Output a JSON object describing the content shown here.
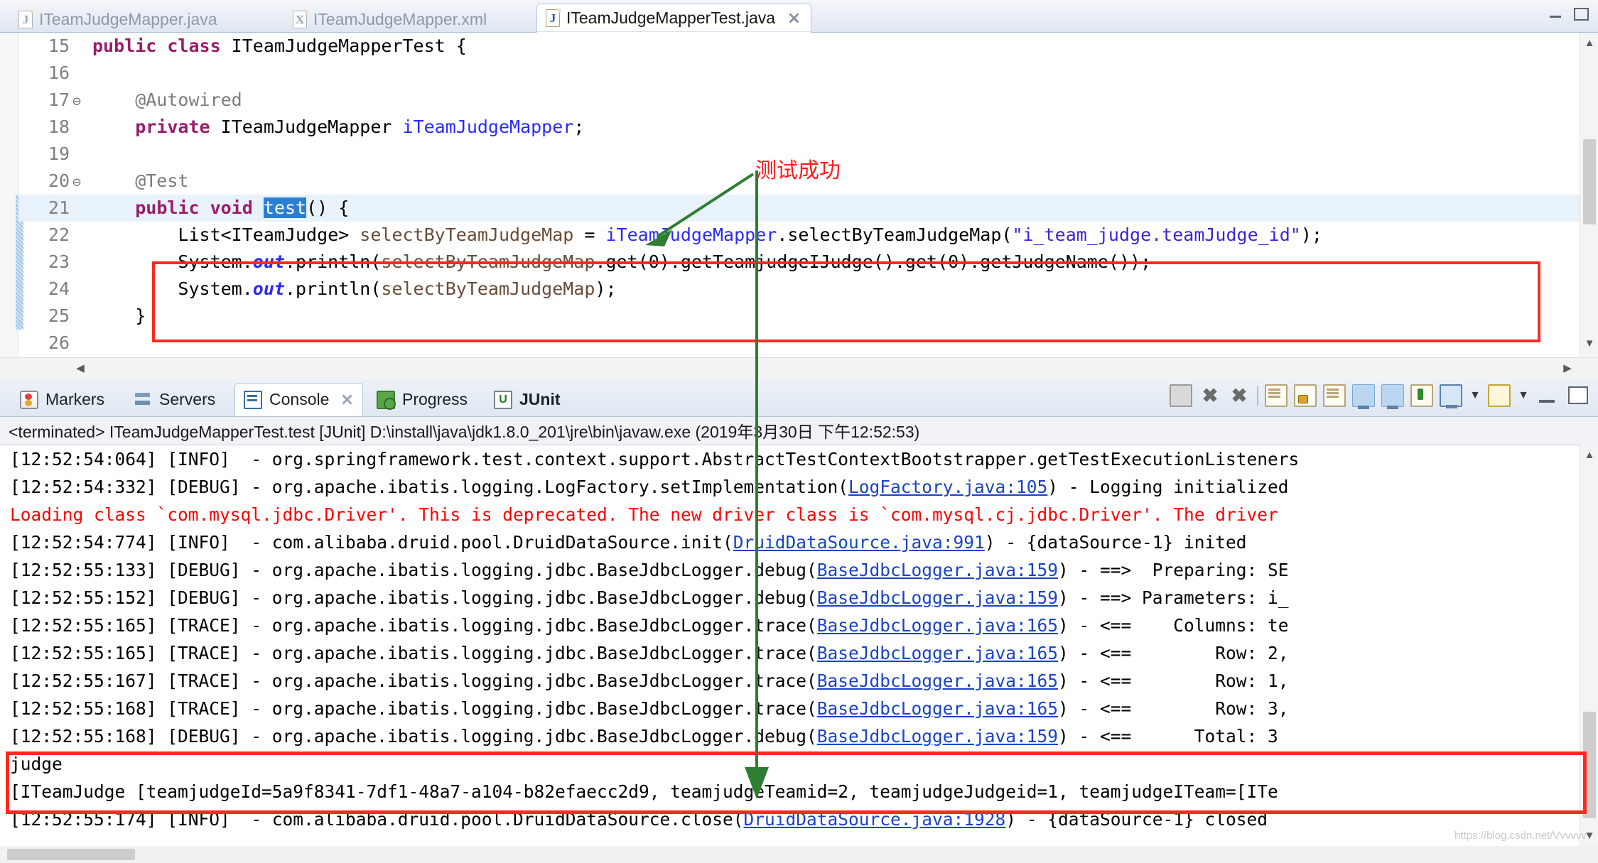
{
  "editor_tabs": [
    {
      "label": "ITeamJudgeMapper.java",
      "icon": "java-file-icon",
      "active": false,
      "closable": false
    },
    {
      "label": "ITeamJudgeMapper.xml",
      "icon": "xml-file-icon",
      "active": false,
      "closable": false
    },
    {
      "label": "ITeamJudgeMapperTest.java",
      "icon": "java-file-icon",
      "active": true,
      "closable": true
    }
  ],
  "window_controls": {
    "minimize": "minimize-icon",
    "maximize": "maximize-icon"
  },
  "code": {
    "lines": [
      {
        "num": "15",
        "fold": "",
        "highlight": false,
        "segments": [
          {
            "t": "public class ",
            "c": "kw"
          },
          {
            "t": "ITeamJudgeMapperTest {",
            "c": "plain"
          }
        ]
      },
      {
        "num": "16",
        "fold": "",
        "highlight": false,
        "segments": [
          {
            "t": "",
            "c": "plain"
          }
        ]
      },
      {
        "num": "17",
        "fold": "⊖",
        "highlight": false,
        "segments": [
          {
            "t": "    @Autowired",
            "c": "ann"
          }
        ]
      },
      {
        "num": "18",
        "fold": "",
        "highlight": false,
        "segments": [
          {
            "t": "    ",
            "c": "plain"
          },
          {
            "t": "private ",
            "c": "kw"
          },
          {
            "t": "ITeamJudgeMapper ",
            "c": "plain"
          },
          {
            "t": "iTeamJudgeMapper",
            "c": "fld"
          },
          {
            "t": ";",
            "c": "plain"
          }
        ]
      },
      {
        "num": "19",
        "fold": "",
        "highlight": false,
        "segments": [
          {
            "t": "",
            "c": "plain"
          }
        ]
      },
      {
        "num": "20",
        "fold": "⊖",
        "highlight": false,
        "segments": [
          {
            "t": "    @Test",
            "c": "ann"
          }
        ]
      },
      {
        "num": "21",
        "fold": "",
        "highlight": true,
        "segments": [
          {
            "t": "    ",
            "c": "plain"
          },
          {
            "t": "public void ",
            "c": "kw"
          },
          {
            "t": "test",
            "c": "sel"
          },
          {
            "t": "() {",
            "c": "plain"
          }
        ]
      },
      {
        "num": "22",
        "fold": "",
        "highlight": false,
        "segments": [
          {
            "t": "        List<ITeamJudge> ",
            "c": "plain"
          },
          {
            "t": "selectByTeamJudgeMap",
            "c": "loc"
          },
          {
            "t": " = ",
            "c": "plain"
          },
          {
            "t": "iTeamJudgeMapper",
            "c": "fld"
          },
          {
            "t": ".selectByTeamJudgeMap(",
            "c": "plain"
          },
          {
            "t": "\"i_team_judge.teamJudge_id\"",
            "c": "str"
          },
          {
            "t": ");",
            "c": "plain"
          }
        ]
      },
      {
        "num": "23",
        "fold": "",
        "highlight": false,
        "segments": [
          {
            "t": "        System.",
            "c": "plain"
          },
          {
            "t": "out",
            "c": "stat"
          },
          {
            "t": ".println(",
            "c": "plain"
          },
          {
            "t": "selectByTeamJudgeMap",
            "c": "loc"
          },
          {
            "t": ".get(0).getTeamjudgeIJudge().get(0).getJudgeName());",
            "c": "plain"
          }
        ]
      },
      {
        "num": "24",
        "fold": "",
        "highlight": false,
        "segments": [
          {
            "t": "        System.",
            "c": "plain"
          },
          {
            "t": "out",
            "c": "stat"
          },
          {
            "t": ".println(",
            "c": "plain"
          },
          {
            "t": "selectByTeamJudgeMap",
            "c": "loc"
          },
          {
            "t": ");",
            "c": "plain"
          }
        ]
      },
      {
        "num": "25",
        "fold": "",
        "highlight": false,
        "segments": [
          {
            "t": "    }",
            "c": "plain"
          }
        ]
      },
      {
        "num": "26",
        "fold": "",
        "highlight": false,
        "segments": [
          {
            "t": "",
            "c": "plain"
          }
        ]
      }
    ]
  },
  "annotation": {
    "label": "测试成功",
    "color": "#ff1a1a",
    "arrow_color": "#2e7d32"
  },
  "panel_tabs": [
    {
      "label": "Markers",
      "icon": "markers-icon",
      "active": false
    },
    {
      "label": "Servers",
      "icon": "servers-icon",
      "active": false
    },
    {
      "label": "Console",
      "icon": "console-icon",
      "active": true
    },
    {
      "label": "Progress",
      "icon": "progress-icon",
      "active": false
    },
    {
      "label": "JUnit",
      "icon": "junit-icon",
      "active": false
    }
  ],
  "panel_toolbar": [
    {
      "name": "terminate-button",
      "icon": "stop-square-icon"
    },
    {
      "name": "remove-launch-button",
      "icon": "x-icon"
    },
    {
      "name": "remove-all-terminated-button",
      "icon": "double-x-icon"
    },
    {
      "name": "clear-console-button",
      "icon": "clear-doc-icon"
    },
    {
      "name": "scroll-lock-button",
      "icon": "lock-icon"
    },
    {
      "name": "word-wrap-button",
      "icon": "wrap-doc-icon"
    },
    {
      "name": "show-console-on-output-button",
      "icon": "monitor-out-icon"
    },
    {
      "name": "show-console-on-error-button",
      "icon": "monitor-err-icon"
    },
    {
      "name": "pin-console-button",
      "icon": "pin-icon"
    },
    {
      "name": "display-selected-console-button",
      "icon": "monitor-icon"
    },
    {
      "name": "display-selected-console-dropdown",
      "icon": "chevron-down-icon"
    },
    {
      "name": "open-console-button",
      "icon": "new-console-icon"
    },
    {
      "name": "open-console-dropdown",
      "icon": "chevron-down-icon"
    },
    {
      "name": "minimize-panel-button",
      "icon": "minimize-icon"
    },
    {
      "name": "maximize-panel-button",
      "icon": "maximize-icon"
    }
  ],
  "console": {
    "terminated_line": "<terminated> ITeamJudgeMapperTest.test [JUnit] D:\\install\\java\\jdk1.8.0_201\\jre\\bin\\javaw.exe (2019年3月30日 下午12:52:53)",
    "lines": [
      {
        "error": false,
        "segments": [
          {
            "t": "[12:52:54:064] [INFO]  - org.springframework.test.context.support.AbstractTestContextBootstrapper.getTestExecutionListeners",
            "link": false
          }
        ]
      },
      {
        "error": false,
        "segments": [
          {
            "t": "[12:52:54:332] [DEBUG] - org.apache.ibatis.logging.LogFactory.setImplementation(",
            "link": false
          },
          {
            "t": "LogFactory.java:105",
            "link": true
          },
          {
            "t": ") - Logging initialized",
            "link": false
          }
        ]
      },
      {
        "error": true,
        "segments": [
          {
            "t": "Loading class `com.mysql.jdbc.Driver'. This is deprecated. The new driver class is `com.mysql.cj.jdbc.Driver'. The driver",
            "link": false
          }
        ]
      },
      {
        "error": false,
        "segments": [
          {
            "t": "[12:52:54:774] [INFO]  - com.alibaba.druid.pool.DruidDataSource.init(",
            "link": false
          },
          {
            "t": "DruidDataSource.java:991",
            "link": true
          },
          {
            "t": ") - {dataSource-1} inited",
            "link": false
          }
        ]
      },
      {
        "error": false,
        "segments": [
          {
            "t": "[12:52:55:133] [DEBUG] - org.apache.ibatis.logging.jdbc.BaseJdbcLogger.debug(",
            "link": false
          },
          {
            "t": "BaseJdbcLogger.java:159",
            "link": true
          },
          {
            "t": ") - ==>  Preparing: SE",
            "link": false
          }
        ]
      },
      {
        "error": false,
        "segments": [
          {
            "t": "[12:52:55:152] [DEBUG] - org.apache.ibatis.logging.jdbc.BaseJdbcLogger.debug(",
            "link": false
          },
          {
            "t": "BaseJdbcLogger.java:159",
            "link": true
          },
          {
            "t": ") - ==> Parameters: i_",
            "link": false
          }
        ]
      },
      {
        "error": false,
        "segments": [
          {
            "t": "[12:52:55:165] [TRACE] - org.apache.ibatis.logging.jdbc.BaseJdbcLogger.trace(",
            "link": false
          },
          {
            "t": "BaseJdbcLogger.java:165",
            "link": true
          },
          {
            "t": ") - <==    Columns: te",
            "link": false
          }
        ]
      },
      {
        "error": false,
        "segments": [
          {
            "t": "[12:52:55:165] [TRACE] - org.apache.ibatis.logging.jdbc.BaseJdbcLogger.trace(",
            "link": false
          },
          {
            "t": "BaseJdbcLogger.java:165",
            "link": true
          },
          {
            "t": ") - <==        Row: 2,",
            "link": false
          }
        ]
      },
      {
        "error": false,
        "segments": [
          {
            "t": "[12:52:55:167] [TRACE] - org.apache.ibatis.logging.jdbc.BaseJdbcLogger.trace(",
            "link": false
          },
          {
            "t": "BaseJdbcLogger.java:165",
            "link": true
          },
          {
            "t": ") - <==        Row: 1,",
            "link": false
          }
        ]
      },
      {
        "error": false,
        "segments": [
          {
            "t": "[12:52:55:168] [TRACE] - org.apache.ibatis.logging.jdbc.BaseJdbcLogger.trace(",
            "link": false
          },
          {
            "t": "BaseJdbcLogger.java:165",
            "link": true
          },
          {
            "t": ") - <==        Row: 3,",
            "link": false
          }
        ]
      },
      {
        "error": false,
        "segments": [
          {
            "t": "[12:52:55:168] [DEBUG] - org.apache.ibatis.logging.jdbc.BaseJdbcLogger.debug(",
            "link": false
          },
          {
            "t": "BaseJdbcLogger.java:159",
            "link": true
          },
          {
            "t": ") - <==      Total: 3",
            "link": false
          }
        ]
      },
      {
        "error": false,
        "segments": [
          {
            "t": "judge",
            "link": false
          }
        ]
      },
      {
        "error": false,
        "segments": [
          {
            "t": "[ITeamJudge [teamjudgeId=5a9f8341-7df1-48a7-a104-b82efaecc2d9, teamjudgeTeamid=2, teamjudgeJudgeid=1, teamjudgeITeam=[ITe",
            "link": false
          }
        ]
      },
      {
        "error": false,
        "segments": [
          {
            "t": "[12:52:55:174] [INFO]  - com.alibaba.druid.pool.DruidDataSource.close(",
            "link": false
          },
          {
            "t": "DruidDataSource.java:1928",
            "link": true
          },
          {
            "t": ") - {dataSource-1} closed",
            "link": false
          }
        ]
      }
    ]
  },
  "watermark": "https://blog.csdn.net/Vvvvvv"
}
